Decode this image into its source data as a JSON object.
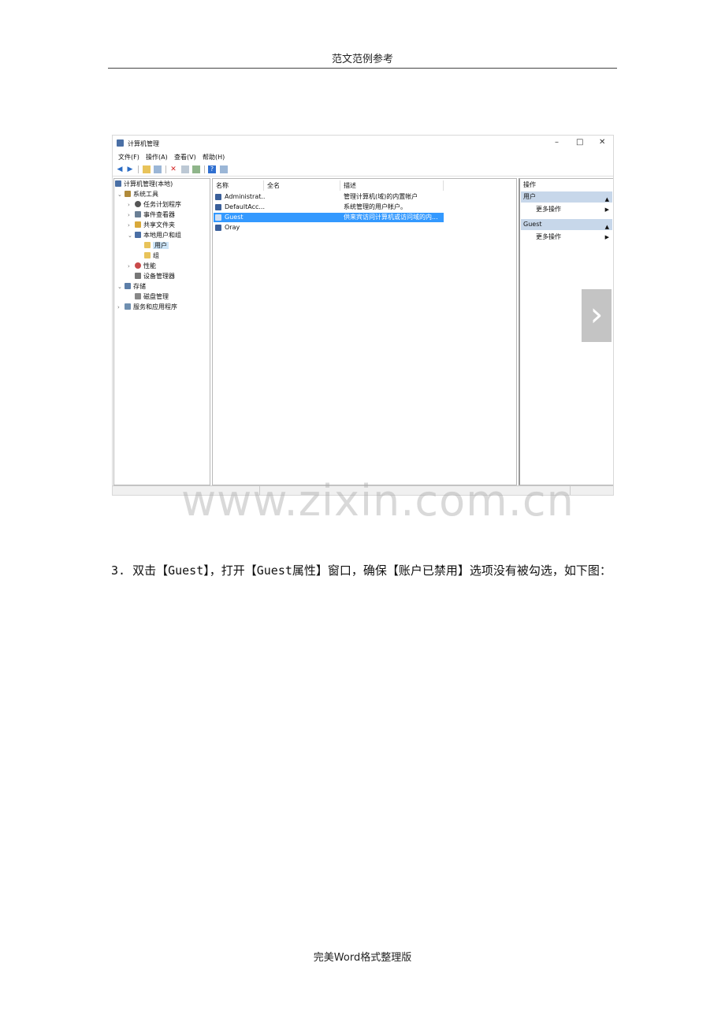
{
  "header": {
    "text": "范文范例参考"
  },
  "footer": {
    "text": "完美Word格式整理版"
  },
  "watermark": "www.zixin.com.cn",
  "window": {
    "title": "计算机管理",
    "controls": {
      "minimize": "–",
      "maximize": "□",
      "close": "✕"
    },
    "menu": [
      "文件(F)",
      "操作(A)",
      "查看(V)",
      "帮助(H)"
    ]
  },
  "tree": [
    {
      "label": "计算机管理(本地)",
      "arrow": "",
      "icon_color": "#4a6fa5"
    },
    {
      "label": "系统工具",
      "arrow": "⌄",
      "icon_color": "#b08a3a"
    },
    {
      "label": "任务计划程序",
      "arrow": "›",
      "icon_color": "#555555"
    },
    {
      "label": "事件查看器",
      "arrow": "›",
      "icon_color": "#6a7f95"
    },
    {
      "label": "共享文件夹",
      "arrow": "›",
      "icon_color": "#d9a93a"
    },
    {
      "label": "本地用户和组",
      "arrow": "⌄",
      "icon_color": "#4a6fa5"
    },
    {
      "label": "用户",
      "arrow": "",
      "icon_color": "#e8c35a"
    },
    {
      "label": "组",
      "arrow": "",
      "icon_color": "#e8c35a"
    },
    {
      "label": "性能",
      "arrow": "›",
      "icon_color": "#c94a4a"
    },
    {
      "label": "设备管理器",
      "arrow": "",
      "icon_color": "#777777"
    },
    {
      "label": "存储",
      "arrow": "⌄",
      "icon_color": "#5c7ea8"
    },
    {
      "label": "磁盘管理",
      "arrow": "",
      "icon_color": "#888888"
    },
    {
      "label": "服务和应用程序",
      "arrow": "›",
      "icon_color": "#6f8fb0"
    }
  ],
  "columns": {
    "name": "名称",
    "fullname": "全名",
    "desc": "描述"
  },
  "users": [
    {
      "name": "Administrat...",
      "fullname": "",
      "desc": "管理计算机(域)的内置帐户"
    },
    {
      "name": "DefaultAcc...",
      "fullname": "",
      "desc": "系统管理的用户帐户。"
    },
    {
      "name": "Guest",
      "fullname": "",
      "desc": "供来宾访问计算机或访问域的内..."
    },
    {
      "name": "Oray",
      "fullname": "",
      "desc": ""
    }
  ],
  "actions": {
    "header": "操作",
    "section1": "用户",
    "section2": "Guest",
    "more": "更多操作",
    "collapse_glyph": "▲",
    "expand_glyph": "▶"
  },
  "next_arrow": "›",
  "step": {
    "text": "3. 双击【Guest】，打开【Guest属性】窗口，确保【账户已禁用】选项没有被勾选，如下图："
  },
  "colors": {
    "selection": "#3399ff",
    "action_section": "#c7d7ea"
  }
}
